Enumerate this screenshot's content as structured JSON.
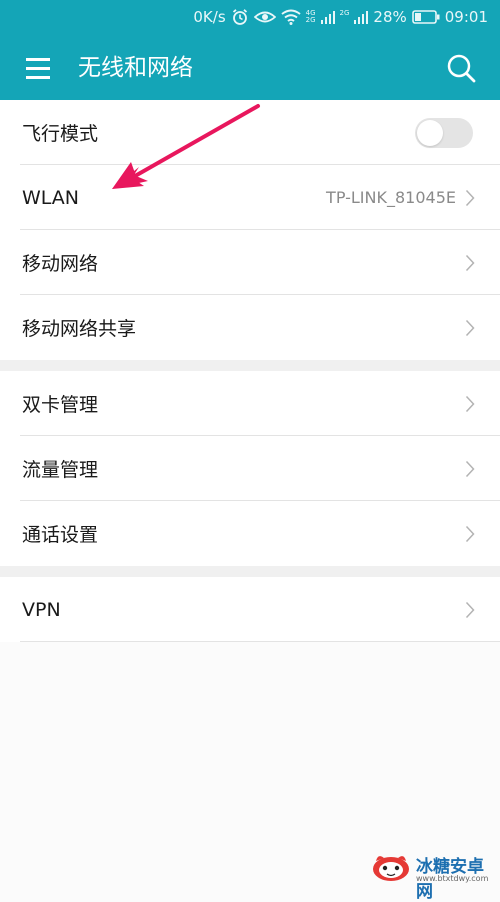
{
  "status_bar": {
    "speed": "0K/s",
    "network_label_top": "4G",
    "network_label_bottom": "2G",
    "network2_label": "2G",
    "battery": "28%",
    "time": "09:01"
  },
  "app_bar": {
    "title": "无线和网络",
    "menu_icon": "hamburger-menu-icon",
    "search_icon": "search-icon"
  },
  "sections": [
    {
      "rows": [
        {
          "label": "飞行模式",
          "control": "toggle",
          "toggle_on": false
        },
        {
          "label": "WLAN",
          "value": "TP-LINK_81045E",
          "control": "chevron"
        },
        {
          "label": "移动网络",
          "control": "chevron"
        },
        {
          "label": "移动网络共享",
          "control": "chevron"
        }
      ]
    },
    {
      "rows": [
        {
          "label": "双卡管理",
          "control": "chevron"
        },
        {
          "label": "流量管理",
          "control": "chevron"
        },
        {
          "label": "通话设置",
          "control": "chevron"
        }
      ]
    },
    {
      "rows": [
        {
          "label": "VPN",
          "control": "chevron"
        }
      ]
    }
  ],
  "annotation": {
    "type": "arrow",
    "color": "#e8175d"
  },
  "watermark": {
    "name": "冰糖安卓网",
    "url": "www.btxtdwy.com"
  },
  "colors": {
    "accent": "#14a5b7",
    "text": "#1a1a1a",
    "value": "#8a8a8a",
    "divider": "#e3e3e3"
  }
}
